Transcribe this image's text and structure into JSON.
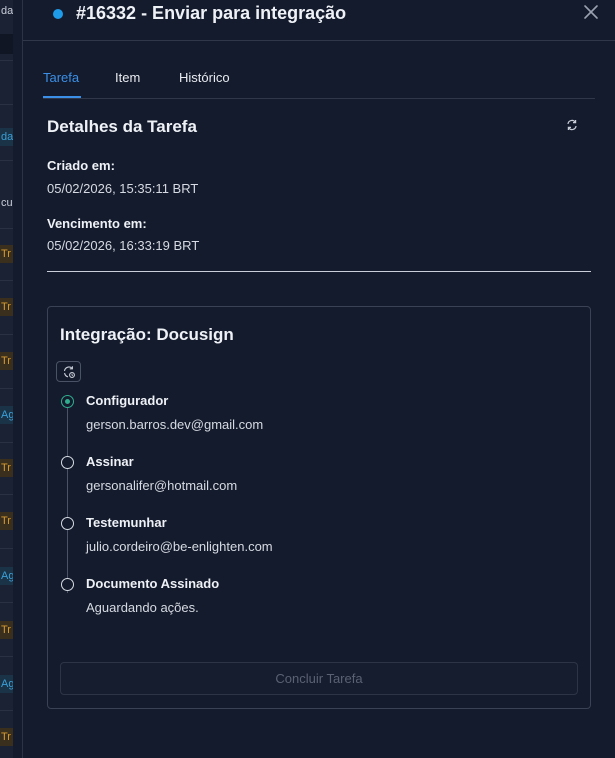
{
  "background": {
    "fragments": [
      "da",
      "da",
      "cus",
      "Tr",
      "Tr",
      "Tr",
      "Ag",
      "Tr",
      "Tr",
      "Ag",
      "Tr",
      "Ag",
      "Tr"
    ]
  },
  "header": {
    "status_color": "#1e9be9",
    "title": "#16332 - Enviar para integração"
  },
  "tabs": [
    {
      "label": "Tarefa",
      "active": true
    },
    {
      "label": "Item",
      "active": false
    },
    {
      "label": "Histórico",
      "active": false
    }
  ],
  "details": {
    "title": "Detalhes da Tarefa",
    "created_label": "Criado em:",
    "created_value": "05/02/2026, 15:35:11 BRT",
    "due_label": "Vencimento em:",
    "due_value": "05/02/2026, 16:33:19 BRT"
  },
  "integration": {
    "title": "Integração: Docusign",
    "steps": [
      {
        "title": "Configurador",
        "subtitle": "gerson.barros.dev@gmail.com",
        "active": true
      },
      {
        "title": "Assinar",
        "subtitle": "gersonalifer@hotmail.com",
        "active": false
      },
      {
        "title": "Testemunhar",
        "subtitle": "julio.cordeiro@be-enlighten.com",
        "active": false
      },
      {
        "title": "Documento Assinado",
        "subtitle": "Aguardando ações.",
        "active": false
      }
    ],
    "finish_button": "Concluir Tarefa"
  },
  "colors": {
    "accent": "#3b8fe6",
    "active_step": "#2fae8f",
    "background": "#141b2c"
  }
}
